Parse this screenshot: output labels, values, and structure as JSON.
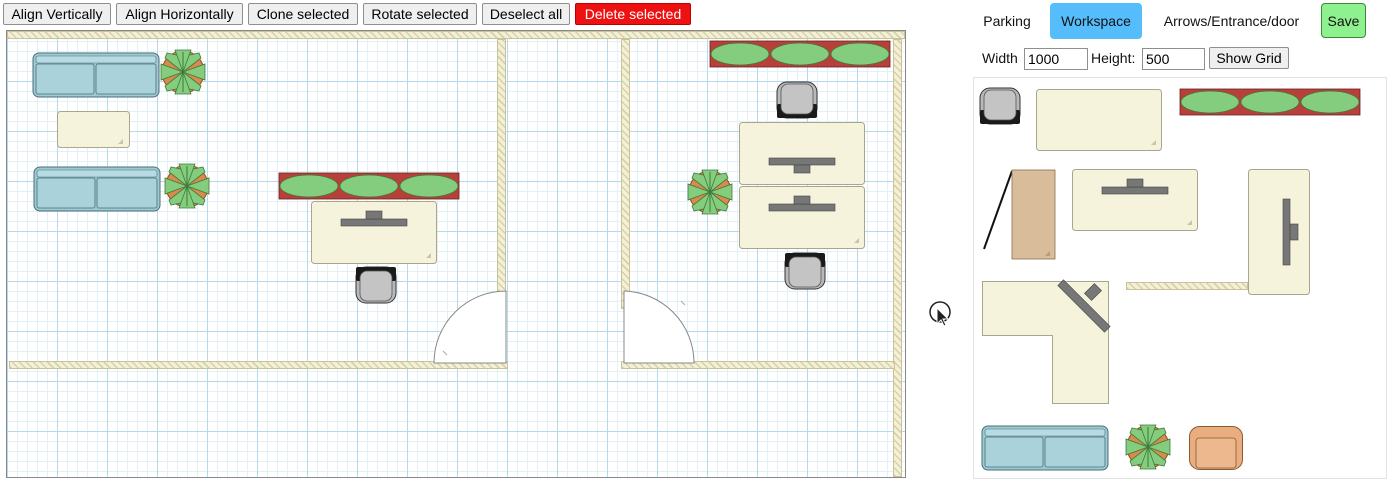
{
  "toolbar": {
    "align_vertically": "Align Vertically",
    "align_horizontally": "Align Horizontally",
    "clone_selected": "Clone selected",
    "rotate_selected": "Rotate selected",
    "deselect_all": "Deselect all",
    "delete_selected": "Delete selected"
  },
  "tabs": {
    "parking": "Parking",
    "workspace": "Workspace",
    "arrows": "Arrows/Entrance/door",
    "save": "Save"
  },
  "size": {
    "width_label": "Width",
    "width_value": "1000",
    "height_label": "Height:",
    "height_value": "500",
    "show_grid": "Show Grid"
  },
  "colors": {
    "active_tab": "#56bdfd",
    "save": "#8ff08f",
    "delete": "#ee1111",
    "desk": "#f5f3dc",
    "sofa": "#9fcad3",
    "plant_leaf": "#84cc7e",
    "plant_pot": "#d98a4d",
    "wall": "#f3f0d8",
    "armchair": "#e9ad7f",
    "door_wood": "#d9bd9b"
  },
  "palette_items": [
    "chair-icon",
    "desk-icon",
    "planter-row-icon",
    "door-icon",
    "workstation-desk-icon",
    "vertical-workstation-icon",
    "wall-segment-icon",
    "l-shaped-desk-icon",
    "sofa-icon",
    "plant-icon",
    "armchair-icon"
  ]
}
